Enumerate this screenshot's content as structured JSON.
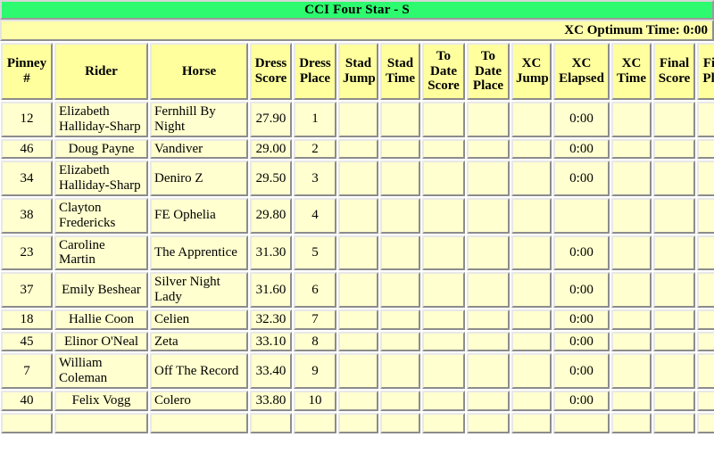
{
  "event": {
    "title": "CCI Four Star - S",
    "xc_optimum_time_label": "XC Optimum Time: 0:00",
    "title_bar_color": "#2dfa6e",
    "header_cell_color": "#ffff9e",
    "data_cell_color": "#ffffcf"
  },
  "table": {
    "columns": [
      {
        "key": "pinney",
        "lines": [
          "Pinney",
          "#"
        ]
      },
      {
        "key": "rider",
        "lines": [
          "Rider"
        ]
      },
      {
        "key": "horse",
        "lines": [
          "Horse"
        ]
      },
      {
        "key": "dress_score",
        "lines": [
          "Dress",
          "Score"
        ]
      },
      {
        "key": "dress_place",
        "lines": [
          "Dress",
          "Place"
        ]
      },
      {
        "key": "stad_jump",
        "lines": [
          "Stad",
          "Jump"
        ]
      },
      {
        "key": "stad_time",
        "lines": [
          "Stad",
          "Time"
        ]
      },
      {
        "key": "to_date_score",
        "lines": [
          "To",
          "Date",
          "Score"
        ]
      },
      {
        "key": "to_date_place",
        "lines": [
          "To",
          "Date",
          "Place"
        ]
      },
      {
        "key": "xc_jump",
        "lines": [
          "XC",
          "Jump"
        ]
      },
      {
        "key": "xc_elapsed",
        "lines": [
          "XC",
          "Elapsed"
        ]
      },
      {
        "key": "xc_time",
        "lines": [
          "XC",
          "Time"
        ]
      },
      {
        "key": "final_score",
        "lines": [
          "Final",
          "Score"
        ]
      },
      {
        "key": "final_place",
        "lines": [
          "Final",
          "Place"
        ]
      }
    ],
    "rows": [
      {
        "pinney": "12",
        "rider": "Elizabeth Halliday-Sharp",
        "horse": "Fernhill By Night",
        "dress_score": "27.90",
        "dress_place": "1",
        "stad_jump": "",
        "stad_time": "",
        "to_date_score": "",
        "to_date_place": "",
        "xc_jump": "",
        "xc_elapsed": "0:00",
        "xc_time": "",
        "final_score": "",
        "final_place": ""
      },
      {
        "pinney": "46",
        "rider": "Doug Payne",
        "horse": "Vandiver",
        "dress_score": "29.00",
        "dress_place": "2",
        "stad_jump": "",
        "stad_time": "",
        "to_date_score": "",
        "to_date_place": "",
        "xc_jump": "",
        "xc_elapsed": "0:00",
        "xc_time": "",
        "final_score": "",
        "final_place": ""
      },
      {
        "pinney": "34",
        "rider": "Elizabeth Halliday-Sharp",
        "horse": "Deniro Z",
        "dress_score": "29.50",
        "dress_place": "3",
        "stad_jump": "",
        "stad_time": "",
        "to_date_score": "",
        "to_date_place": "",
        "xc_jump": "",
        "xc_elapsed": "0:00",
        "xc_time": "",
        "final_score": "",
        "final_place": ""
      },
      {
        "pinney": "38",
        "rider": "Clayton Fredericks",
        "horse": "FE Ophelia",
        "dress_score": "29.80",
        "dress_place": "4",
        "stad_jump": "",
        "stad_time": "",
        "to_date_score": "",
        "to_date_place": "",
        "xc_jump": "",
        "xc_elapsed": "",
        "xc_time": "",
        "final_score": "",
        "final_place": ""
      },
      {
        "pinney": "23",
        "rider": "Caroline Martin",
        "horse": "The Apprentice",
        "dress_score": "31.30",
        "dress_place": "5",
        "stad_jump": "",
        "stad_time": "",
        "to_date_score": "",
        "to_date_place": "",
        "xc_jump": "",
        "xc_elapsed": "0:00",
        "xc_time": "",
        "final_score": "",
        "final_place": ""
      },
      {
        "pinney": "37",
        "rider": "Emily Beshear",
        "horse": "Silver Night Lady",
        "dress_score": "31.60",
        "dress_place": "6",
        "stad_jump": "",
        "stad_time": "",
        "to_date_score": "",
        "to_date_place": "",
        "xc_jump": "",
        "xc_elapsed": "0:00",
        "xc_time": "",
        "final_score": "",
        "final_place": ""
      },
      {
        "pinney": "18",
        "rider": "Hallie Coon",
        "horse": "Celien",
        "dress_score": "32.30",
        "dress_place": "7",
        "stad_jump": "",
        "stad_time": "",
        "to_date_score": "",
        "to_date_place": "",
        "xc_jump": "",
        "xc_elapsed": "0:00",
        "xc_time": "",
        "final_score": "",
        "final_place": ""
      },
      {
        "pinney": "45",
        "rider": "Elinor O'Neal",
        "horse": "Zeta",
        "dress_score": "33.10",
        "dress_place": "8",
        "stad_jump": "",
        "stad_time": "",
        "to_date_score": "",
        "to_date_place": "",
        "xc_jump": "",
        "xc_elapsed": "0:00",
        "xc_time": "",
        "final_score": "",
        "final_place": ""
      },
      {
        "pinney": "7",
        "rider": "William Coleman",
        "horse": "Off The Record",
        "dress_score": "33.40",
        "dress_place": "9",
        "stad_jump": "",
        "stad_time": "",
        "to_date_score": "",
        "to_date_place": "",
        "xc_jump": "",
        "xc_elapsed": "0:00",
        "xc_time": "",
        "final_score": "",
        "final_place": ""
      },
      {
        "pinney": "40",
        "rider": "Felix Vogg",
        "horse": "Colero",
        "dress_score": "33.80",
        "dress_place": "10",
        "stad_jump": "",
        "stad_time": "",
        "to_date_score": "",
        "to_date_place": "",
        "xc_jump": "",
        "xc_elapsed": "0:00",
        "xc_time": "",
        "final_score": "",
        "final_place": ""
      },
      {
        "pinney": "",
        "rider": "",
        "horse": "",
        "dress_score": "",
        "dress_place": "",
        "stad_jump": "",
        "stad_time": "",
        "to_date_score": "",
        "to_date_place": "",
        "xc_jump": "",
        "xc_elapsed": "",
        "xc_time": "",
        "final_score": "",
        "final_place": ""
      }
    ]
  }
}
